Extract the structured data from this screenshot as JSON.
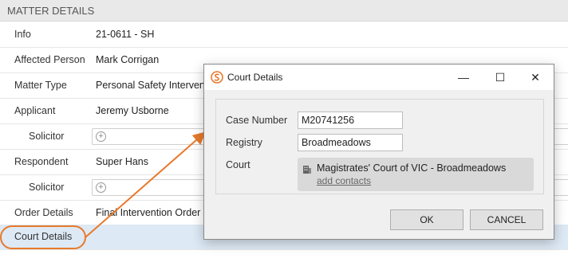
{
  "header": {
    "title": "MATTER DETAILS"
  },
  "rows": [
    {
      "label": "Info",
      "value": "21-0611 - SH"
    },
    {
      "label": "Affected Person",
      "value": "Mark Corrigan"
    },
    {
      "label": "Matter Type",
      "value": "Personal Safety Intervention Order"
    },
    {
      "label": "Applicant",
      "value": "Jeremy Usborne"
    },
    {
      "label": "Solicitor",
      "value": ""
    },
    {
      "label": "Respondent",
      "value": "Super Hans"
    },
    {
      "label": "Solicitor",
      "value": ""
    },
    {
      "label": "Order Details",
      "value": "Final Intervention Order"
    },
    {
      "label": "Court Details",
      "value": ""
    }
  ],
  "dialog": {
    "title": "Court Details",
    "case_number_label": "Case Number",
    "case_number_value": "M20741256",
    "registry_label": "Registry",
    "registry_value": "Broadmeadows",
    "court_label": "Court",
    "court_name": "Magistrates' Court of VIC - Broadmeadows",
    "add_contacts": "add contacts",
    "ok_label": "OK",
    "cancel_label": "CANCEL",
    "minimize_glyph": "—",
    "maximize_glyph": "☐",
    "close_glyph": "✕"
  },
  "colors": {
    "accent_orange": "#e8792b",
    "highlight_row": "#dde9f5"
  }
}
